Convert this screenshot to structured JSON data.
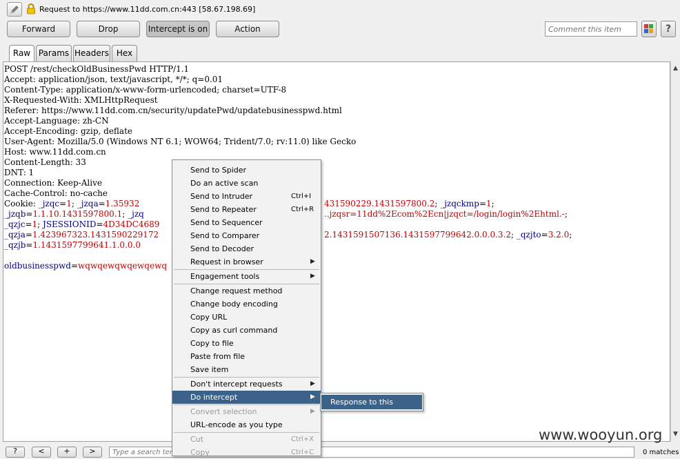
{
  "header": {
    "request_info": "Request to https://www.11dd.com.cn:443  [58.67.198.69]",
    "edit_icon": "pencil-icon",
    "lock_icon": "lock-icon"
  },
  "toolbar": {
    "forward": "Forward",
    "drop": "Drop",
    "intercept": "Intercept is on",
    "action": "Action",
    "comment_placeholder": "Comment this item",
    "help": "?"
  },
  "tabs": [
    "Raw",
    "Params",
    "Headers",
    "Hex"
  ],
  "request": {
    "request_line": "POST /rest/checkOldBusinessPwd HTTP/1.1",
    "accept": "Accept: application/json, text/javascript, */*; q=0.01",
    "content_type": "Content-Type: application/x-www-form-urlencoded; charset=UTF-8",
    "x_requested_with": "X-Requested-With: XMLHttpRequest",
    "referer": "Referer: https://www.11dd.com.cn/security/updatePwd/updatebusinesspwd.html",
    "accept_language": "Accept-Language: zh-CN",
    "accept_encoding": "Accept-Encoding: gzip, deflate",
    "user_agent": "User-Agent: Mozilla/5.0 (Windows NT 6.1; WOW64; Trident/7.0; rv:11.0) like Gecko",
    "host": "Host: www.11dd.com.cn",
    "content_length": "Content-Length: 33",
    "dnt": "DNT: 1",
    "connection": "Connection: Keep-Alive",
    "cache_control": "Cache-Control: no-cache",
    "cookie": {
      "label": "Cookie: ",
      "c1_name": "_jzqc",
      "c1_val": "1",
      "c2_name": "_jzqa",
      "c2_val": "1.35932",
      "c2_tail": "431590229.1431597800.2",
      "c3_name": "_jzqckmp",
      "c3_val": "1",
      "c4_name": "_jzqb",
      "c4_val": "1.1.10.1431597800.1",
      "c4_tail_name": "_jzq",
      "c5_tail": "..jzqsr=11dd%2Ecom%2Ecn|jzqct=/login/login%2Ehtml.-",
      "c6_name": "_qzjc",
      "c6_val": "1",
      "c7_name": "JSESSIONID",
      "c7_val": "4D34DC4689",
      "c8_name": "_qzja",
      "c8_val": "1.423967323.1431590229172",
      "c8_tail": "2.1431591507136.1431597799642.0.0.0.3.2",
      "c9_name": "_qzjto",
      "c9_val": "3.2.0",
      "c10_name": "_qzjb",
      "c10_val": "1.1431597799641.1.0.0.0"
    },
    "body_name": "oldbusinesspwd",
    "body_val": "wqwqewqwqewqewq"
  },
  "context_menu": {
    "send_to_spider": "Send to Spider",
    "active_scan": "Do an active scan",
    "send_to_intruder": "Send to Intruder",
    "send_to_intruder_sc": "Ctrl+I",
    "send_to_repeater": "Send to Repeater",
    "send_to_repeater_sc": "Ctrl+R",
    "send_to_sequencer": "Send to Sequencer",
    "send_to_comparer": "Send to Comparer",
    "send_to_decoder": "Send to Decoder",
    "request_in_browser": "Request in browser",
    "engagement_tools": "Engagement tools",
    "change_method": "Change request method",
    "change_encoding": "Change body encoding",
    "copy_url": "Copy URL",
    "copy_curl": "Copy as curl command",
    "copy_to_file": "Copy to file",
    "paste_from_file": "Paste from file",
    "save_item": "Save item",
    "dont_intercept": "Don't intercept requests",
    "do_intercept": "Do intercept",
    "convert_selection": "Convert selection",
    "url_encode": "URL-encode as you type",
    "cut": "Cut",
    "cut_sc": "Ctrl+X",
    "copy": "Copy",
    "copy_sc": "Ctrl+C"
  },
  "submenu": {
    "response_to_request": "Response to this request"
  },
  "search": {
    "prev": "<",
    "add": "+",
    "next": ">",
    "help": "?",
    "placeholder": "Type a search term",
    "matches": "0 matches"
  },
  "watermark": "www.wooyun.org",
  "colors": {
    "accent": "#3c6289",
    "param_name": "#000080",
    "param_value": "#c00000"
  }
}
